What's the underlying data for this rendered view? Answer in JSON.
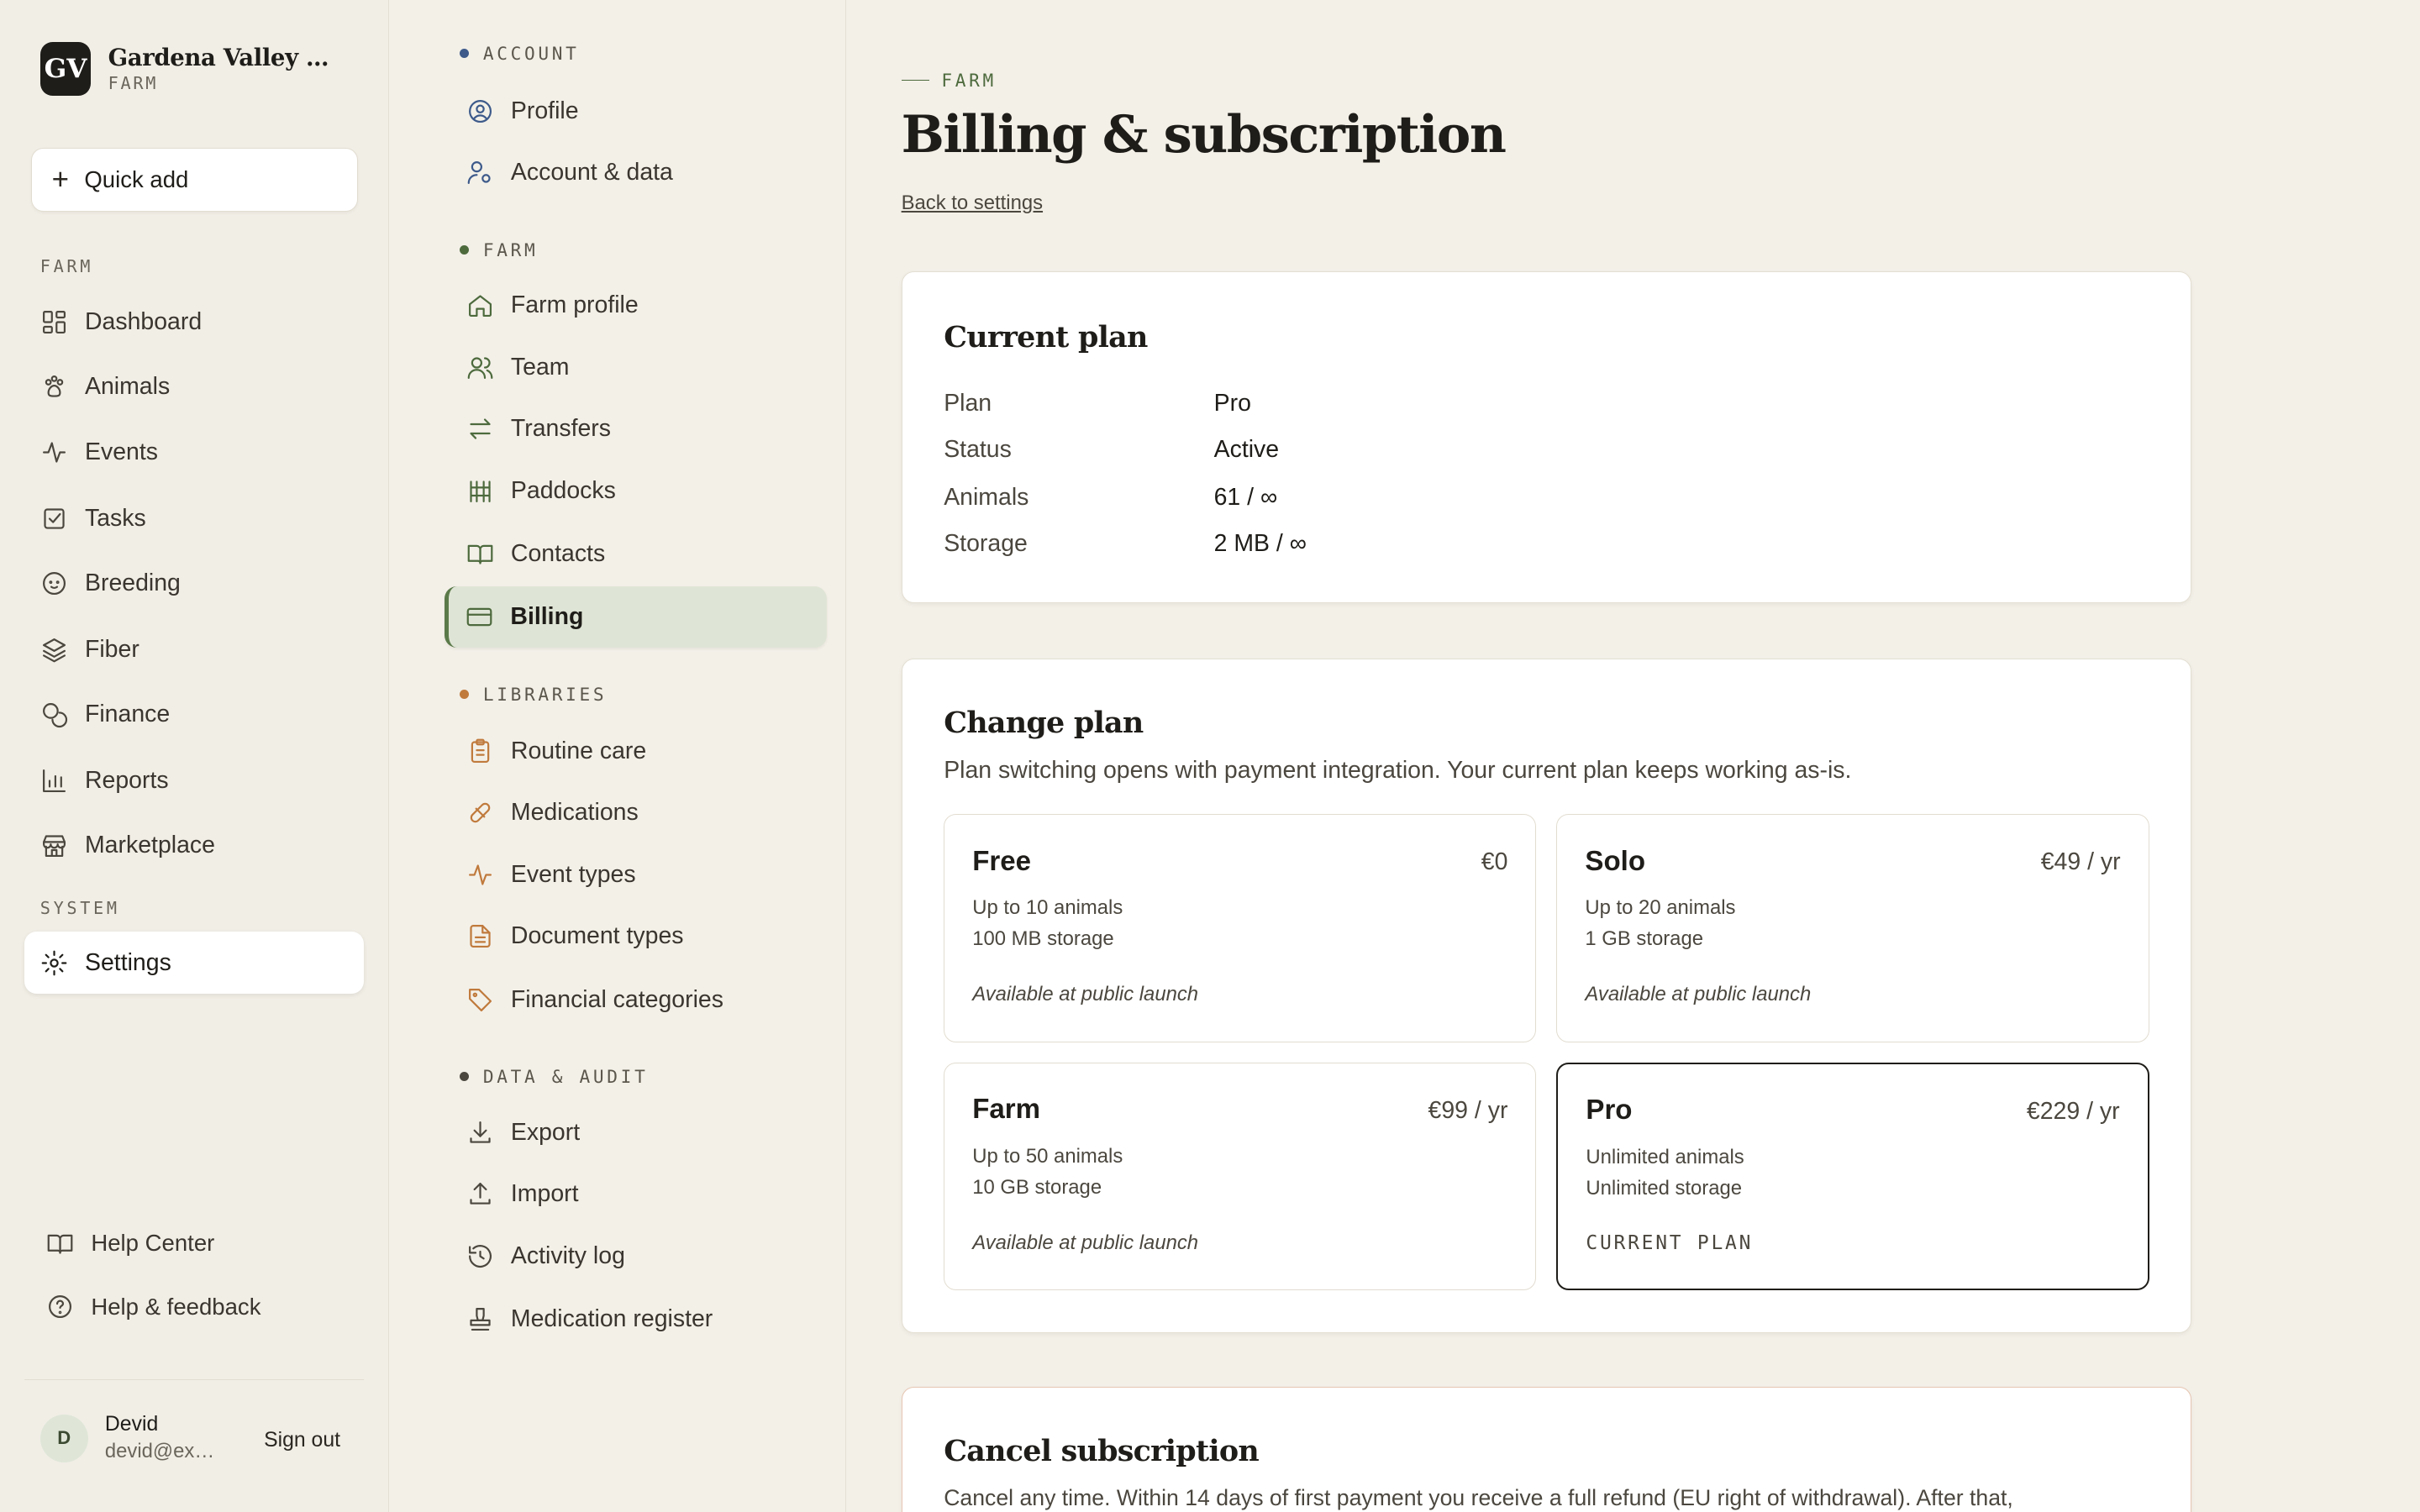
{
  "brand": {
    "logo": "GV",
    "name": "Gardena Valley Alp...",
    "sub": "FARM"
  },
  "quick_add": "Quick add",
  "sidebar": {
    "section_farm": "FARM",
    "items": [
      {
        "label": "Dashboard",
        "icon": "dashboard-icon"
      },
      {
        "label": "Animals",
        "icon": "paw-icon"
      },
      {
        "label": "Events",
        "icon": "activity-icon"
      },
      {
        "label": "Tasks",
        "icon": "checkbox-icon"
      },
      {
        "label": "Breeding",
        "icon": "baby-icon"
      },
      {
        "label": "Fiber",
        "icon": "layers-icon"
      },
      {
        "label": "Finance",
        "icon": "coins-icon"
      },
      {
        "label": "Reports",
        "icon": "bar-chart-icon"
      },
      {
        "label": "Marketplace",
        "icon": "store-icon"
      }
    ],
    "section_system": "SYSTEM",
    "settings": "Settings",
    "help_center": "Help Center",
    "help_feedback": "Help & feedback"
  },
  "user": {
    "initial": "D",
    "name": "Devid",
    "email": "devid@example.com",
    "sign_out": "Sign out"
  },
  "subnav": {
    "sections": [
      {
        "title": "ACCOUNT",
        "dot_color": "#3d5a8a",
        "items": [
          "Profile",
          "Account & data"
        ]
      },
      {
        "title": "FARM",
        "dot_color": "#4d6a3d",
        "items": [
          "Farm profile",
          "Team",
          "Transfers",
          "Paddocks",
          "Contacts",
          "Billing"
        ]
      },
      {
        "title": "LIBRARIES",
        "dot_color": "#c07a3c",
        "items": [
          "Routine care",
          "Medications",
          "Event types",
          "Document types",
          "Financial categories"
        ]
      },
      {
        "title": "DATA & AUDIT",
        "dot_color": "#4b473f",
        "items": [
          "Export",
          "Import",
          "Activity log",
          "Medication register"
        ]
      }
    ],
    "active": "Billing"
  },
  "main": {
    "crumb": "FARM",
    "title": "Billing & subscription",
    "back": "Back to settings",
    "current_plan": {
      "title": "Current plan",
      "rows": [
        {
          "key": "Plan",
          "value": "Pro"
        },
        {
          "key": "Status",
          "value": "Active"
        },
        {
          "key": "Animals",
          "value": "61 / ∞"
        },
        {
          "key": "Storage",
          "value": "2 MB / ∞"
        }
      ]
    },
    "change_plan": {
      "title": "Change plan",
      "desc": "Plan switching opens with payment integration. Your current plan keeps working as-is.",
      "plans": [
        {
          "name": "Free",
          "price": "€0",
          "f1": "Up to 10 animals",
          "f2": "100 MB storage",
          "note": "Available at public launch"
        },
        {
          "name": "Solo",
          "price": "€49 / yr",
          "f1": "Up to 20 animals",
          "f2": "1 GB storage",
          "note": "Available at public launch"
        },
        {
          "name": "Farm",
          "price": "€99 / yr",
          "f1": "Up to 50 animals",
          "f2": "10 GB storage",
          "note": "Available at public launch"
        },
        {
          "name": "Pro",
          "price": "€229 / yr",
          "f1": "Unlimited animals",
          "f2": "Unlimited storage",
          "note": "CURRENT PLAN"
        }
      ]
    },
    "cancel": {
      "title": "Cancel subscription",
      "desc": "Cancel any time. Within 14 days of first payment you receive a full refund (EU right of withdrawal). After that,"
    }
  }
}
